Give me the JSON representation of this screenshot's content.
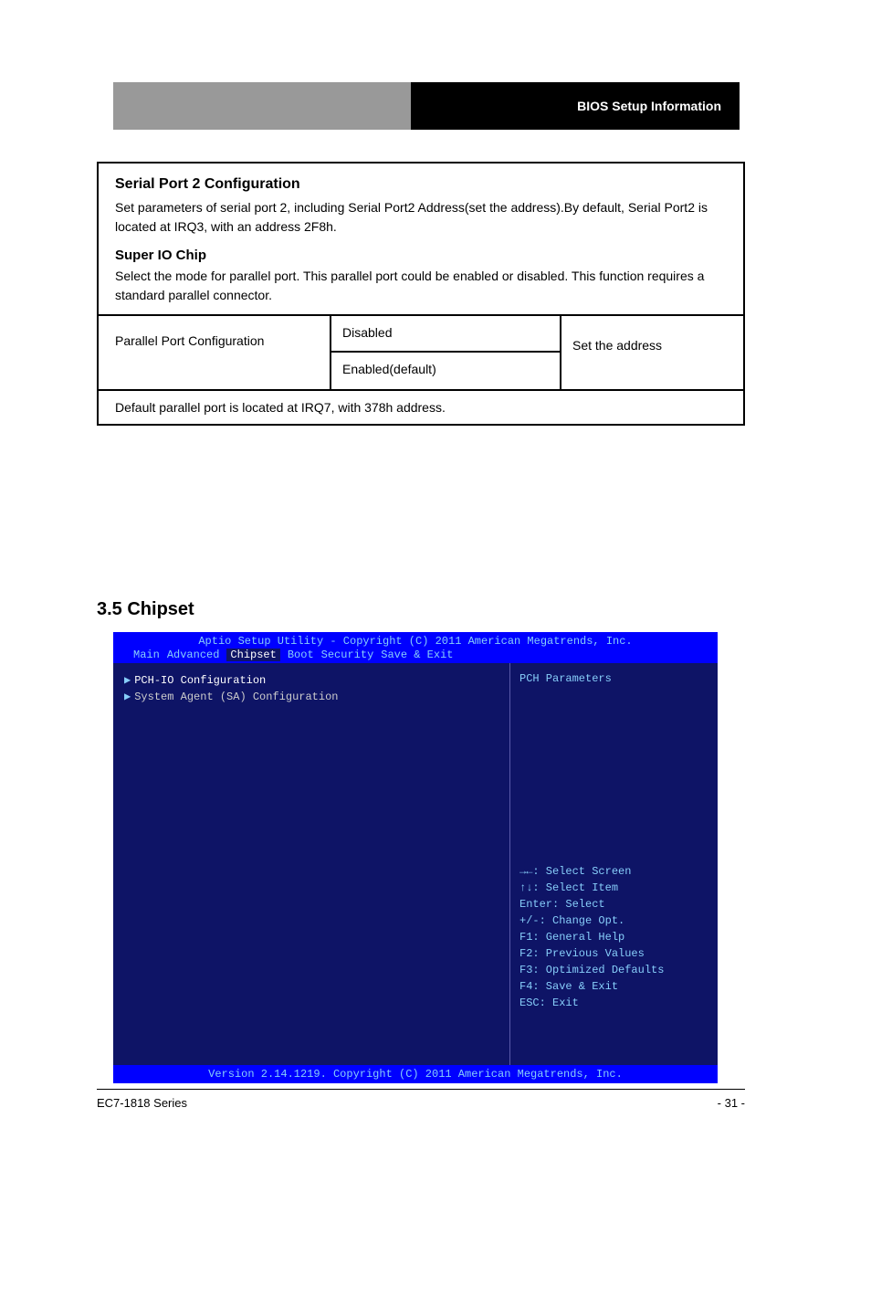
{
  "header": {
    "right_text": "BIOS Setup Information"
  },
  "config": {
    "title": "Serial Port 2 Configuration",
    "desc": "Set parameters of serial port 2, including Serial Port2 Address(set the address).By default, Serial Port2 is located at IRQ3, with an address 2F8h.",
    "sub": "Super IO Chip",
    "subdesc": "Select the mode for parallel port. This parallel port could be enabled or disabled. This function requires a standard parallel connector.",
    "col1": "Parallel Port Configuration",
    "col2_top": "Disabled",
    "col2_bot": "Enabled(default)",
    "col3": "Set the address",
    "footer": "Default parallel port is located at IRQ7, with 378h address."
  },
  "chipset_heading": "3.5  Chipset",
  "bios": {
    "title": "Aptio Setup Utility - Copyright (C) 2011 American Megatrends, Inc.",
    "tabs": [
      "Main",
      "Advanced",
      "Chipset",
      "Boot",
      "Security",
      "Save & Exit"
    ],
    "active_tab": "Chipset",
    "items": [
      "PCH-IO Configuration",
      "System Agent (SA) Configuration"
    ],
    "help_title": "PCH Parameters",
    "hints": [
      "→←: Select Screen",
      "↑↓: Select Item",
      "Enter: Select",
      "+/-: Change Opt.",
      "F1: General Help",
      "F2: Previous Values",
      "F3: Optimized Defaults",
      "F4: Save & Exit",
      "ESC: Exit"
    ],
    "footer": "Version 2.14.1219. Copyright (C) 2011 American Megatrends, Inc."
  },
  "page_footer": {
    "left": "EC7-1818 Series",
    "right": "- 31 -"
  }
}
